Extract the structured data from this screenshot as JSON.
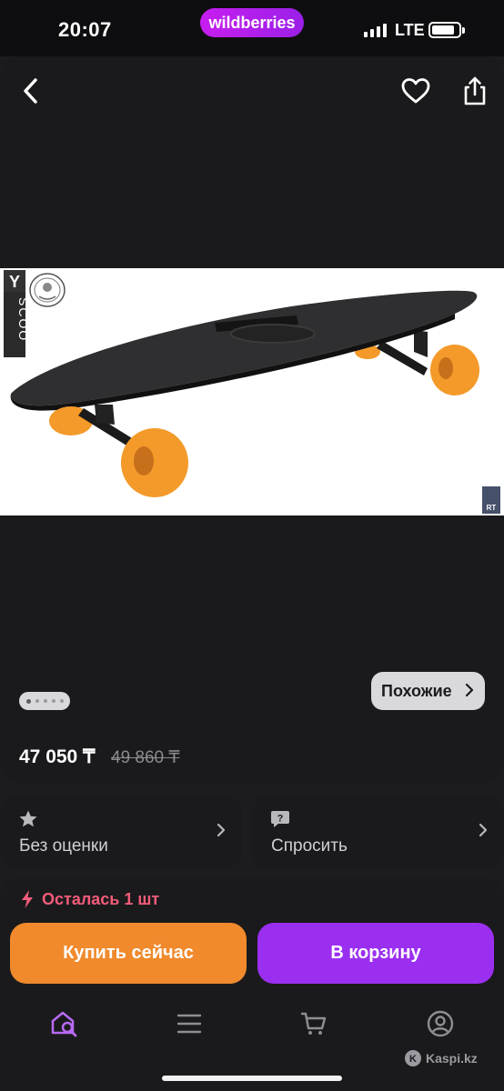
{
  "status_bar": {
    "time": "20:07",
    "network": "LTE"
  },
  "brand": {
    "name": "wildberries",
    "color": "#b31ff0"
  },
  "header": {
    "back_icon": "chevron-left-icon",
    "favorite_icon": "heart-icon",
    "share_icon": "share-icon"
  },
  "gallery": {
    "image_description_icon": "skateboard-photo",
    "logo_text": "Y SCOO",
    "badge_text": "RT",
    "dots_count": 5,
    "active_dot": 0,
    "similar_button": "Похожие"
  },
  "price": {
    "current": "47 050 ₸",
    "old": "49 860 ₸"
  },
  "cards": [
    {
      "icon": "star-icon",
      "label": "Без оценки"
    },
    {
      "icon": "question-bubble-icon",
      "label": "Спросить"
    }
  ],
  "stock": {
    "icon": "lightning-icon",
    "text": "Осталась 1 шт",
    "color": "#f45c79"
  },
  "actions": {
    "buy_now": "Купить сейчас",
    "add_to_cart": "В корзину",
    "buy_color": "#f08a2c",
    "cart_color": "#9b2ff0"
  },
  "tabbar": [
    {
      "icon": "home-search-icon",
      "active": true
    },
    {
      "icon": "menu-icon",
      "active": false
    },
    {
      "icon": "cart-icon",
      "active": false
    },
    {
      "icon": "profile-icon",
      "active": false
    }
  ],
  "watermark": "Kaspi.kz"
}
